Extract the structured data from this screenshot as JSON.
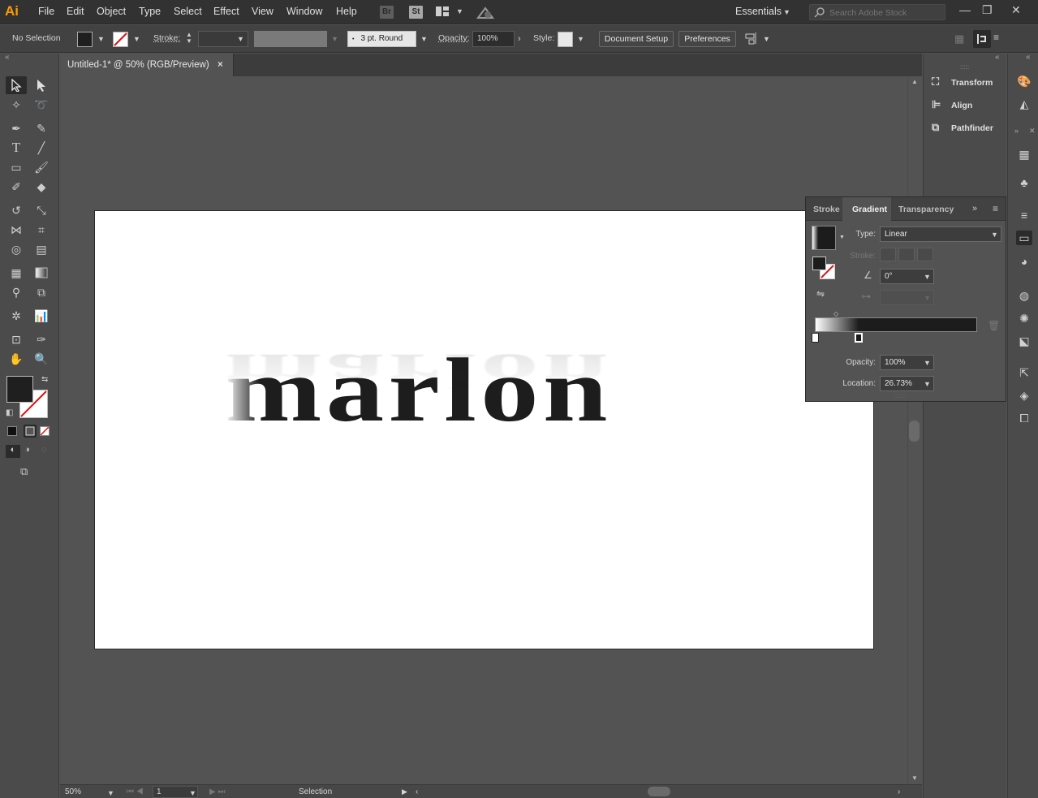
{
  "app": {
    "logo": "Ai",
    "menu": [
      "File",
      "Edit",
      "Object",
      "Type",
      "Select",
      "Effect",
      "View",
      "Window",
      "Help"
    ],
    "bridge": "Br",
    "stock": "St",
    "workspace": "Essentials",
    "search_placeholder": "Search Adobe Stock"
  },
  "control": {
    "selection": "No Selection",
    "stroke_label": "Stroke:",
    "brush": "3 pt. Round",
    "opacity_label": "Opacity:",
    "opacity_value": "100%",
    "style_label": "Style:",
    "document_setup": "Document Setup",
    "preferences": "Preferences"
  },
  "document": {
    "tab_title": "Untitled-1* @ 50% (RGB/Preview)",
    "close": "×",
    "artwork_text": "marlon"
  },
  "status": {
    "zoom": "50%",
    "page": "1",
    "tool": "Selection"
  },
  "side_panels": {
    "items": [
      "Transform",
      "Align",
      "Pathfinder"
    ]
  },
  "gradient_panel": {
    "tabs": [
      "Stroke",
      "Gradient",
      "Transparency"
    ],
    "type_label": "Type:",
    "type_value": "Linear",
    "stroke_label": "Stroke:",
    "angle_value": "0°",
    "opacity_label": "Opacity:",
    "opacity_value": "100%",
    "location_label": "Location:",
    "location_value": "26.73%"
  }
}
